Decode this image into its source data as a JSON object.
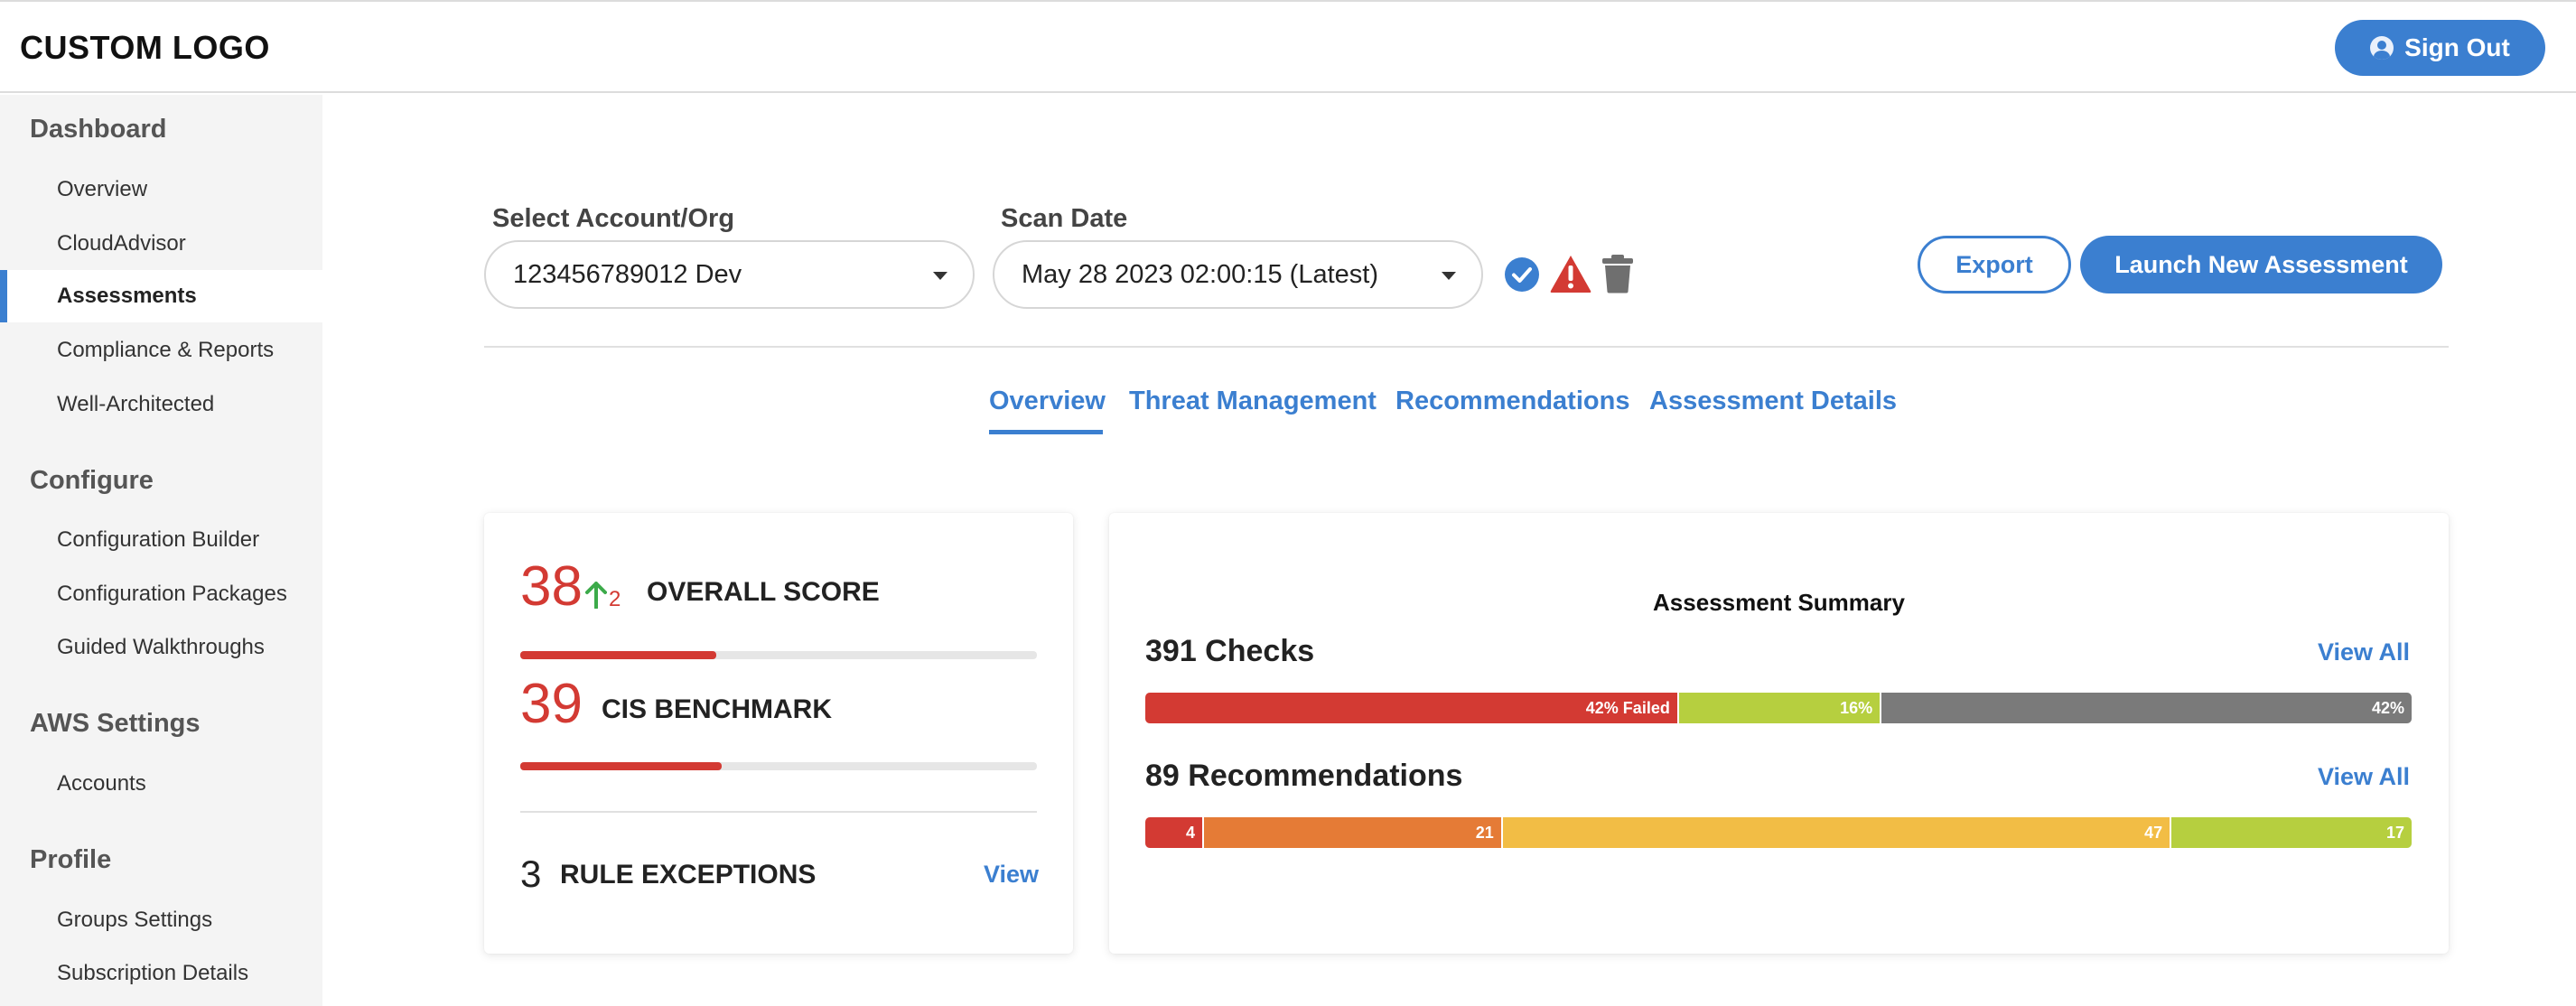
{
  "app": {
    "logo": "CUSTOM LOGO",
    "sign_out": "Sign Out"
  },
  "sidebar": {
    "sections": [
      {
        "title": "Dashboard",
        "items": [
          "Overview",
          "CloudAdvisor",
          "Assessments",
          "Compliance & Reports",
          "Well-Architected"
        ]
      },
      {
        "title": "Configure",
        "items": [
          "Configuration Builder",
          "Configuration Packages",
          "Guided Walkthroughs"
        ]
      },
      {
        "title": "AWS Settings",
        "items": [
          "Accounts"
        ]
      },
      {
        "title": "Profile",
        "items": [
          "Groups Settings",
          "Subscription Details"
        ]
      }
    ],
    "active_item": "Assessments"
  },
  "filters": {
    "account_label": "Select Account/Org",
    "account_value": "123456789012 Dev",
    "scan_label": "Scan Date",
    "scan_value": "May 28 2023 02:00:15 (Latest)"
  },
  "actions": {
    "export": "Export",
    "launch": "Launch New Assessment"
  },
  "tabs": [
    "Overview",
    "Threat Management",
    "Recommendations",
    "Assessment Details"
  ],
  "active_tab": "Overview",
  "scores": {
    "overall_value": "38",
    "overall_delta": "2",
    "overall_label": "OVERALL SCORE",
    "overall_fraction": 0.38,
    "cis_value": "39",
    "cis_label": "CIS BENCHMARK",
    "cis_fraction": 0.39,
    "exceptions_value": "3",
    "exceptions_label": "RULE EXCEPTIONS",
    "exceptions_link": "View"
  },
  "summary": {
    "title": "Assessment Summary",
    "checks_label": "391 Checks",
    "checks_link": "View All",
    "checks_segments": [
      {
        "label": "42% Failed",
        "value": 42,
        "color": "#d33a33"
      },
      {
        "label": "16%",
        "value": 16,
        "color": "#b6cf3f"
      },
      {
        "label": "42%",
        "value": 42,
        "color": "#7a7a7a"
      }
    ],
    "recs_label": "89 Recommendations",
    "recs_link": "View All",
    "recs_segments": [
      {
        "label": "4",
        "value": 4,
        "color": "#d33a33"
      },
      {
        "label": "21",
        "value": 21,
        "color": "#e57b36"
      },
      {
        "label": "47",
        "value": 47,
        "color": "#f2bd45"
      },
      {
        "label": "17",
        "value": 17,
        "color": "#b6cf3f"
      }
    ]
  },
  "colors": {
    "accent": "#3b7fd0",
    "danger": "#d33a33",
    "up": "#3caa4a"
  },
  "icons": [
    "user-icon",
    "check-circle-icon",
    "warning-triangle-icon",
    "trash-icon",
    "arrow-up-icon",
    "chevron-down-icon"
  ]
}
